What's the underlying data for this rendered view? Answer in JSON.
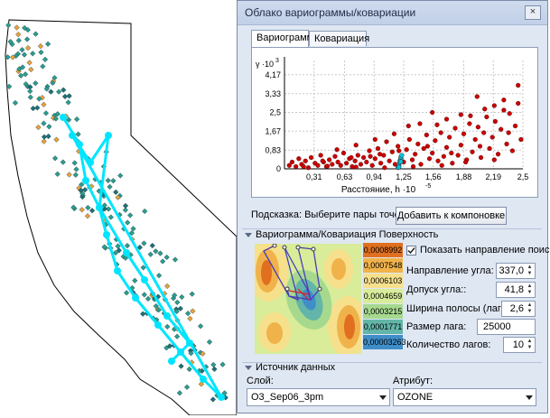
{
  "window": {
    "title": "Облако вариограммы/ковариации",
    "close_glyph": "×"
  },
  "tabs": [
    {
      "label": "Вариограмма",
      "active": true
    },
    {
      "label": "Ковариация",
      "active": false
    }
  ],
  "chart_data": {
    "type": "scatter",
    "ylabel": "γ ·10",
    "ylabel_exp": "3",
    "xlabel": "Расстояние, h ·10",
    "xlabel_exp": "-5",
    "y_ticks": [
      "0",
      "0,83",
      "1,67",
      "2,5",
      "3,33",
      "4,17"
    ],
    "y_tick_values": [
      0,
      0.83,
      1.67,
      2.5,
      3.33,
      4.17
    ],
    "x_ticks": [
      "0,31",
      "0,63",
      "0,94",
      "1,25",
      "1,56",
      "1,88",
      "2,19",
      "2,5"
    ],
    "x_tick_values": [
      0.31,
      0.63,
      0.94,
      1.25,
      1.56,
      1.88,
      2.19,
      2.5
    ],
    "xlim": [
      0,
      2.5
    ],
    "ylim": [
      0,
      4.8
    ],
    "grid": true,
    "series": [
      {
        "color": "#cc0000",
        "points": [
          [
            0.05,
            0.15
          ],
          [
            0.08,
            0.3
          ],
          [
            0.12,
            0.1
          ],
          [
            0.15,
            0.45
          ],
          [
            0.18,
            0.2
          ],
          [
            0.22,
            0.35
          ],
          [
            0.25,
            0.05
          ],
          [
            0.28,
            0.5
          ],
          [
            0.32,
            0.25
          ],
          [
            0.35,
            0.15
          ],
          [
            0.38,
            0.6
          ],
          [
            0.41,
            0.3
          ],
          [
            0.44,
            0.1
          ],
          [
            0.47,
            0.4
          ],
          [
            0.5,
            0.2
          ],
          [
            0.53,
            0.55
          ],
          [
            0.56,
            0.3
          ],
          [
            0.59,
            0.15
          ],
          [
            0.62,
            0.7
          ],
          [
            0.65,
            0.25
          ],
          [
            0.68,
            0.45
          ],
          [
            0.71,
            0.1
          ],
          [
            0.74,
            0.35
          ],
          [
            0.77,
            0.6
          ],
          [
            0.8,
            0.2
          ],
          [
            0.83,
            0.5
          ],
          [
            0.86,
            0.3
          ],
          [
            0.89,
            0.8
          ],
          [
            0.92,
            0.15
          ],
          [
            0.95,
            0.45
          ],
          [
            0.98,
            0.9
          ],
          [
            1.01,
            0.25
          ],
          [
            1.04,
            0.6
          ],
          [
            1.07,
            1.2
          ],
          [
            1.1,
            0.35
          ],
          [
            1.13,
            0.75
          ],
          [
            1.16,
            0.2
          ],
          [
            1.19,
            1.0
          ],
          [
            1.22,
            0.5
          ],
          [
            1.25,
            0.3
          ],
          [
            1.28,
            0.85
          ],
          [
            1.31,
            1.3
          ],
          [
            1.34,
            0.4
          ],
          [
            1.37,
            0.65
          ],
          [
            1.4,
            1.1
          ],
          [
            1.43,
            0.2
          ],
          [
            1.46,
            0.9
          ],
          [
            1.49,
            1.5
          ],
          [
            1.52,
            0.45
          ],
          [
            1.55,
            0.7
          ],
          [
            1.58,
            1.25
          ],
          [
            1.61,
            0.35
          ],
          [
            1.64,
            1.6
          ],
          [
            1.67,
            0.55
          ],
          [
            1.7,
            0.95
          ],
          [
            1.73,
            1.4
          ],
          [
            1.76,
            0.25
          ],
          [
            1.79,
            1.8
          ],
          [
            1.82,
            0.6
          ],
          [
            1.85,
            1.05
          ],
          [
            1.88,
            1.55
          ],
          [
            1.91,
            0.4
          ],
          [
            1.94,
            2.0
          ],
          [
            1.97,
            0.75
          ],
          [
            2.0,
            1.3
          ],
          [
            2.03,
            1.85
          ],
          [
            2.06,
            0.5
          ],
          [
            2.09,
            1.6
          ],
          [
            2.12,
            2.3
          ],
          [
            2.15,
            0.9
          ],
          [
            2.18,
            1.4
          ],
          [
            2.21,
            2.1
          ],
          [
            2.24,
            0.65
          ],
          [
            2.27,
            1.75
          ],
          [
            2.3,
            2.6
          ],
          [
            2.33,
            1.1
          ],
          [
            2.36,
            2.45
          ],
          [
            2.39,
            0.8
          ],
          [
            2.42,
            1.9
          ],
          [
            2.45,
            2.9
          ],
          [
            2.48,
            1.3
          ],
          [
            2.45,
            3.7
          ],
          [
            2.02,
            3.2
          ],
          [
            1.55,
            2.5
          ],
          [
            1.7,
            2.2
          ],
          [
            2.2,
            2.8
          ],
          [
            1.95,
            2.35
          ],
          [
            1.3,
            1.9
          ],
          [
            0.75,
            1.05
          ],
          [
            1.15,
            1.55
          ],
          [
            1.85,
            2.4
          ],
          [
            2.3,
            3.05
          ],
          [
            0.55,
            0.85
          ],
          [
            0.95,
            1.3
          ],
          [
            1.42,
            2.0
          ],
          [
            2.1,
            2.65
          ],
          [
            1.6,
            1.95
          ],
          [
            1.0,
            0.65
          ],
          [
            0.7,
            0.5
          ],
          [
            0.4,
            0.35
          ],
          [
            0.2,
            0.1
          ],
          [
            0.9,
            0.55
          ],
          [
            1.2,
            0.8
          ],
          [
            1.5,
            1.0
          ],
          [
            1.75,
            0.7
          ],
          [
            2.05,
            1.0
          ],
          [
            2.35,
            1.6
          ],
          [
            2.2,
            0.4
          ],
          [
            1.9,
            0.3
          ],
          [
            1.65,
            0.15
          ],
          [
            1.35,
            0.1
          ],
          [
            1.05,
            0.05
          ],
          [
            0.75,
            0.08
          ],
          [
            0.45,
            0.12
          ]
        ]
      },
      {
        "color": "#00c8e0",
        "points": [
          [
            1.19,
            0.05
          ],
          [
            1.2,
            0.12
          ],
          [
            1.2,
            0.2
          ],
          [
            1.21,
            0.28
          ],
          [
            1.21,
            0.36
          ],
          [
            1.22,
            0.44
          ],
          [
            1.22,
            0.52
          ],
          [
            1.23,
            0.6
          ],
          [
            1.2,
            0.08
          ],
          [
            1.22,
            0.32
          ]
        ]
      }
    ]
  },
  "hint": {
    "label": "Подсказка: Выберите пары точек,",
    "add_button": "Добавить к компоновке"
  },
  "surface_section": {
    "title": "Вариограмма/Ковариация Поверхность",
    "legend": [
      {
        "value": "0,0008992",
        "color": "#e07020"
      },
      {
        "value": "0,0007548",
        "color": "#f0b24a"
      },
      {
        "value": "0,0006103",
        "color": "#f6e08c"
      },
      {
        "value": "0,0004659",
        "color": "#d8ec9a"
      },
      {
        "value": "0,0003215",
        "color": "#a6d98e"
      },
      {
        "value": "0,0001771",
        "color": "#62b5a8"
      },
      {
        "value": "0,00003263",
        "color": "#3f8ec8"
      }
    ],
    "show_direction_label": "Показать направление поиска",
    "show_direction_checked": true,
    "angle_direction_label": "Направление угла:",
    "angle_direction_value": "337,0",
    "angle_tolerance_label": "Допуск угла::",
    "angle_tolerance_value": "41,8",
    "bandwidth_label": "Ширина полосы (лаги):",
    "bandwidth_value": "2,6",
    "lag_size_label": "Размер лага:",
    "lag_size_value": "25000",
    "lag_count_label": "Количество лагов:",
    "lag_count_value": "10"
  },
  "data_source": {
    "title": "Источник данных",
    "layer_label": "Слой:",
    "layer_value": "O3_Sep06_3pm",
    "attribute_label": "Атрибут:",
    "attribute_value": "OZONE"
  }
}
